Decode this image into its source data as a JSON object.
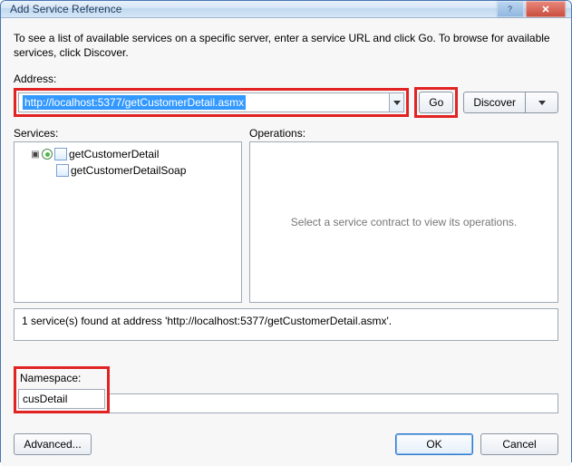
{
  "window": {
    "title": "Add Service Reference"
  },
  "instructions": "To see a list of available services on a specific server, enter a service URL and click Go. To browse for available services, click Discover.",
  "address": {
    "label": "Address:",
    "value": "http://localhost:5377/getCustomerDetail.asmx",
    "go_label": "Go",
    "discover_label": "Discover"
  },
  "services": {
    "label": "Services:",
    "tree": {
      "root": "getCustomerDetail",
      "child": "getCustomerDetailSoap"
    }
  },
  "operations": {
    "label": "Operations:",
    "placeholder": "Select a service contract to view its operations."
  },
  "status": "1 service(s) found at address 'http://localhost:5377/getCustomerDetail.asmx'.",
  "namespace": {
    "label": "Namespace:",
    "value": "cusDetail"
  },
  "buttons": {
    "advanced": "Advanced...",
    "ok": "OK",
    "cancel": "Cancel"
  }
}
